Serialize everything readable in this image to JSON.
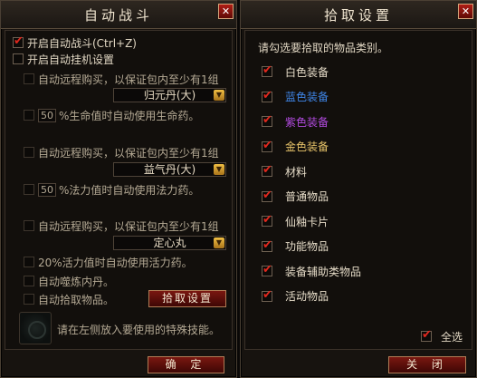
{
  "left_panel": {
    "title": "自动战斗",
    "close": "✕",
    "auto_battle": {
      "label": "开启自动战斗(Ctrl+Z)",
      "checked": true
    },
    "auto_hangup": {
      "label": "开启自动挂机设置",
      "checked": false
    },
    "hp_buy": {
      "label": "自动远程购买，以保证包内至少有1组",
      "item": "归元丹(大)"
    },
    "hp_use": {
      "value": "50",
      "label": "%生命值时自动使用生命药。"
    },
    "mp_buy": {
      "label": "自动远程购买，以保证包内至少有1组",
      "item": "益气丹(大)"
    },
    "mp_use": {
      "value": "50",
      "label": "%法力值时自动使用法力药。"
    },
    "calm_buy": {
      "label": "自动远程购买，以保证包内至少有1组",
      "item": "定心丸"
    },
    "vigor_use": {
      "label": "20%活力值时自动使用活力药。"
    },
    "auto_refine": {
      "label": "自动噬炼内丹。"
    },
    "auto_pickup": {
      "label": "自动拾取物品。"
    },
    "pickup_settings_btn": "拾取设置",
    "skill_hint": "请在左侧放入要使用的特殊技能。",
    "ok_btn": "确 定"
  },
  "right_panel": {
    "title": "拾取设置",
    "close": "✕",
    "prompt": "请勾选要拾取的物品类别。",
    "items": [
      {
        "label": "白色装备",
        "color": "#e6dcc8"
      },
      {
        "label": "蓝色装备",
        "color": "#3f86e8"
      },
      {
        "label": "紫色装备",
        "color": "#b24be0"
      },
      {
        "label": "金色装备",
        "color": "#e8c46a"
      },
      {
        "label": "材料",
        "color": "#e6dcc8"
      },
      {
        "label": "普通物品",
        "color": "#e6dcc8"
      },
      {
        "label": "仙釉卡片",
        "color": "#e6dcc8"
      },
      {
        "label": "功能物品",
        "color": "#e6dcc8"
      },
      {
        "label": "装备辅助类物品",
        "color": "#e6dcc8"
      },
      {
        "label": "活动物品",
        "color": "#e6dcc8"
      }
    ],
    "select_all": "全选",
    "close_btn": "关 闭"
  }
}
